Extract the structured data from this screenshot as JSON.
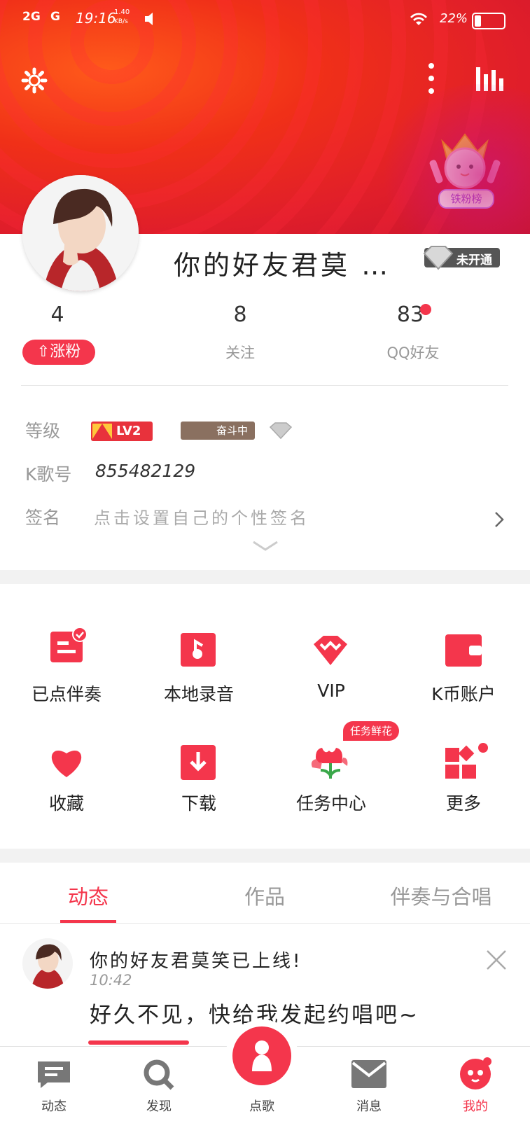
{
  "status_bar": {
    "network": "2G",
    "network2": "G",
    "time": "19:16",
    "speed": "1.40",
    "speed_unit": "KB/s",
    "battery": "22%"
  },
  "profile": {
    "name": "你的好友君莫 …",
    "membership_badge": "未开通",
    "stats": [
      {
        "value": "4",
        "label": "涨粉"
      },
      {
        "value": "8",
        "label": "关注"
      },
      {
        "value": "83",
        "label": "QQ好友"
      }
    ],
    "level_label": "等级",
    "level_badge": "LV2",
    "level_status": "奋斗中",
    "kid_label": "K歌号",
    "kid_value": "855482129",
    "sign_label": "签名",
    "sign_placeholder": "点击设置自己的个性签名",
    "fans_rank": "铁粉榜"
  },
  "grid": [
    {
      "label": "已点伴奏",
      "icon": "list-check-icon"
    },
    {
      "label": "本地录音",
      "icon": "music-note-icon"
    },
    {
      "label": "VIP",
      "icon": "diamond-icon"
    },
    {
      "label": "K币账户",
      "icon": "wallet-icon"
    },
    {
      "label": "收藏",
      "icon": "heart-icon"
    },
    {
      "label": "下载",
      "icon": "download-icon"
    },
    {
      "label": "任务中心",
      "icon": "flower-icon",
      "badge": "任务鲜花"
    },
    {
      "label": "更多",
      "icon": "more-grid-icon"
    }
  ],
  "tabs": [
    {
      "label": "动态",
      "active": true
    },
    {
      "label": "作品",
      "active": false
    },
    {
      "label": "伴奏与合唱",
      "active": false
    }
  ],
  "feed": {
    "title": "你的好友君莫笑已上线!",
    "time": "10:42",
    "message": "好久不见，快给我发起约唱吧~"
  },
  "bottom_nav": [
    {
      "label": "动态",
      "icon": "chat-icon"
    },
    {
      "label": "发现",
      "icon": "search-icon"
    },
    {
      "label": "点歌",
      "icon": "sing-icon"
    },
    {
      "label": "消息",
      "icon": "mail-icon"
    },
    {
      "label": "我的",
      "icon": "profile-icon"
    }
  ],
  "colors": {
    "accent": "#f4364c",
    "header": "#ee2a1e"
  }
}
